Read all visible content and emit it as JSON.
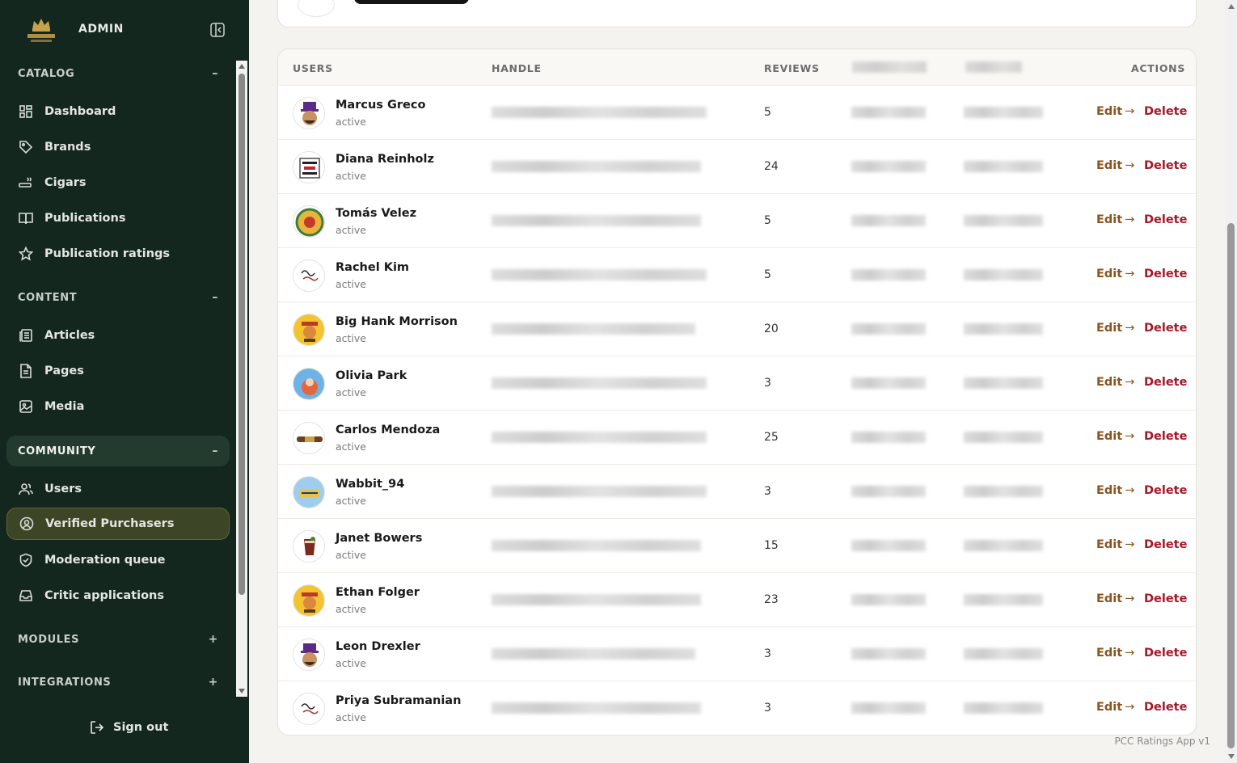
{
  "sidebar": {
    "admin_label": "ADMIN",
    "sections": {
      "catalog": {
        "label": "CATALOG",
        "toggle": "–"
      },
      "content": {
        "label": "CONTENT",
        "toggle": "–"
      },
      "community": {
        "label": "COMMUNITY",
        "toggle": "–"
      },
      "modules": {
        "label": "MODULES",
        "toggle": "+"
      },
      "integrations": {
        "label": "INTEGRATIONS",
        "toggle": "+"
      }
    },
    "items": {
      "dashboard": "Dashboard",
      "brands": "Brands",
      "cigars": "Cigars",
      "publications": "Publications",
      "publication_ratings": "Publication ratings",
      "articles": "Articles",
      "pages": "Pages",
      "media": "Media",
      "users": "Users",
      "verified_purchasers": "Verified Purchasers",
      "moderation_queue": "Moderation queue",
      "critic_applications": "Critic applications"
    },
    "sign_out": "Sign out"
  },
  "table": {
    "headers": {
      "users": "USERS",
      "handle": "HANDLE",
      "reviews": "REVIEWS",
      "actions": "ACTIONS"
    },
    "edit_label": "Edit",
    "edit_arrow": "→",
    "delete_label": "Delete",
    "rows": [
      {
        "name": "Marcus Greco",
        "status": "active",
        "reviews": "5",
        "avatar": "purple-hat-man"
      },
      {
        "name": "Diana Reinholz",
        "status": "active",
        "reviews": "24",
        "avatar": "do-not-buy-this-sign"
      },
      {
        "name": "Tomás Velez",
        "status": "active",
        "reviews": "5",
        "avatar": "cartoon-badge"
      },
      {
        "name": "Rachel Kim",
        "status": "active",
        "reviews": "5",
        "avatar": "script-logo"
      },
      {
        "name": "Big Hank Morrison",
        "status": "active",
        "reviews": "20",
        "avatar": "yellow-cowboy-badge"
      },
      {
        "name": "Olivia Park",
        "status": "active",
        "reviews": "3",
        "avatar": "sky-character"
      },
      {
        "name": "Carlos Mendoza",
        "status": "active",
        "reviews": "25",
        "avatar": "cigar-band"
      },
      {
        "name": "Wabbit_94",
        "status": "active",
        "reviews": "3",
        "avatar": "blue-badge"
      },
      {
        "name": "Janet Bowers",
        "status": "active",
        "reviews": "15",
        "avatar": "cocktail-glass"
      },
      {
        "name": "Ethan Folger",
        "status": "active",
        "reviews": "23",
        "avatar": "yellow-cowboy-badge"
      },
      {
        "name": "Leon Drexler",
        "status": "active",
        "reviews": "3",
        "avatar": "purple-hat-man"
      },
      {
        "name": "Priya Subramanian",
        "status": "active",
        "reviews": "3",
        "avatar": "script-logo"
      }
    ]
  },
  "footer": {
    "version": "PCC Ratings App v1"
  },
  "colors": {
    "sidebar_bg": "#13271f",
    "active_item_bg": "#3c4526",
    "edit": "#8a5420",
    "delete": "#a4192a"
  }
}
